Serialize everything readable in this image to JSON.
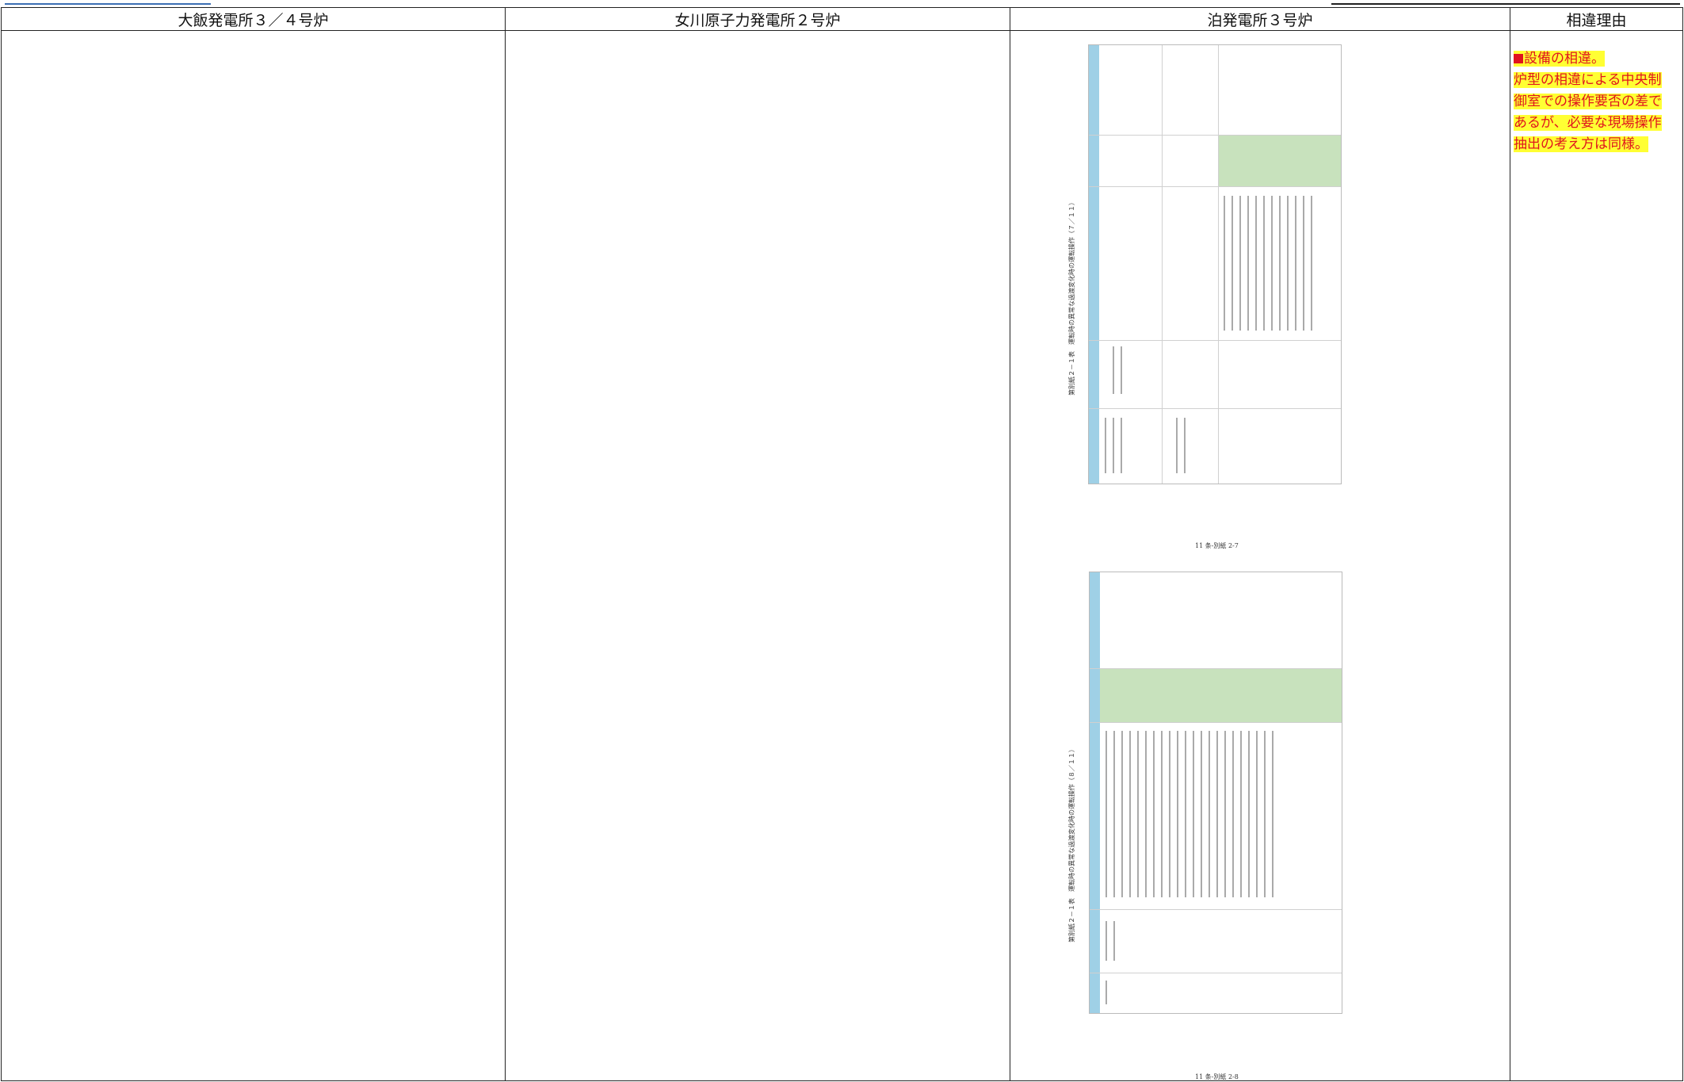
{
  "columns": [
    "大飯発電所３／４号炉",
    "女川原子力発電所２号炉",
    "泊発電所３号炉",
    "相違理由"
  ],
  "tomari": {
    "figures": [
      {
        "title": "第別紙２－１表　運転時の異常な過渡変化時の運転操作（７／１１）",
        "caption": "11 条-別紙 2-7"
      },
      {
        "title": "第別紙２－１表　運転時の異常な過渡変化時の運転操作（８／１１）",
        "caption": "11 条-別紙 2-8"
      }
    ]
  },
  "reason": {
    "heading": "設備の相違。",
    "lines": [
      "炉型の相違による中央制",
      "御室での操作要否の差で",
      "あるが、必要な現場操作",
      "抽出の考え方は同様。"
    ]
  }
}
